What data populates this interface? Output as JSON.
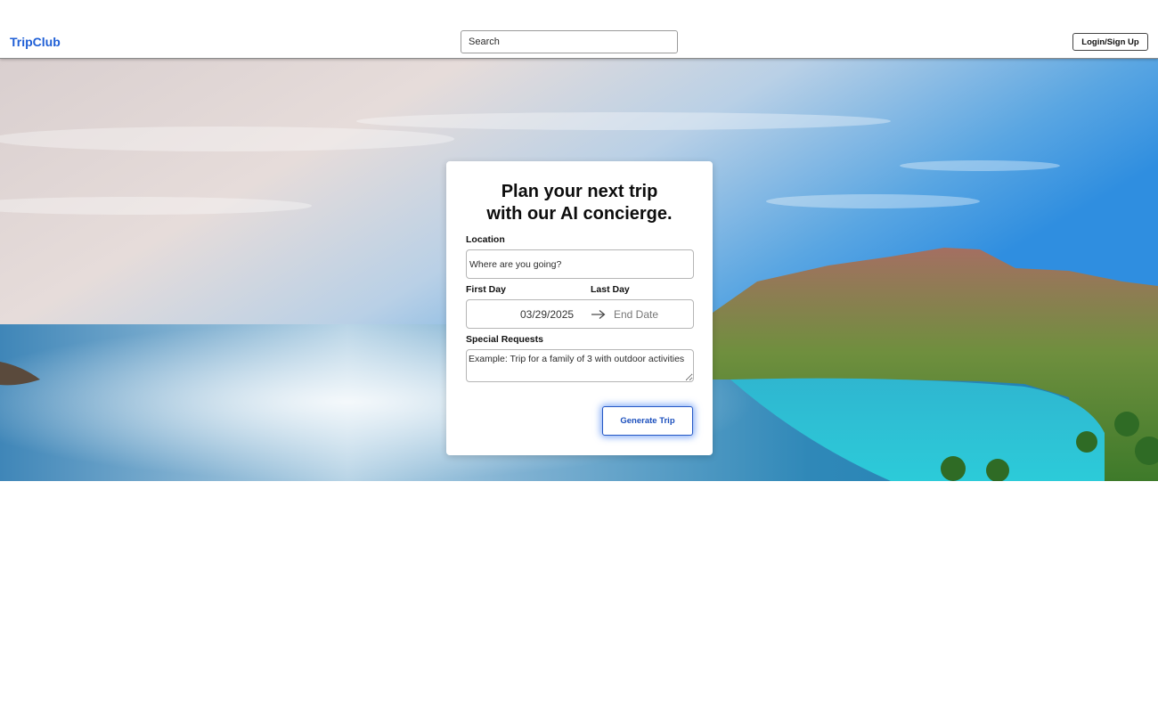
{
  "header": {
    "brand": "TripClub",
    "search_placeholder": "Search",
    "login_label": "Login/Sign Up"
  },
  "planner": {
    "title_line1": "Plan your next trip",
    "title_line2": "with our AI concierge.",
    "location_label": "Location",
    "location_placeholder": "Where are you going?",
    "first_day_label": "First Day",
    "last_day_label": "Last Day",
    "start_date": "03/29/2025",
    "end_date_placeholder": "End Date",
    "requests_label": "Special Requests",
    "requests_placeholder": "Example: Trip for a family of 3 with outdoor activities",
    "generate_label": "Generate Trip"
  },
  "colors": {
    "brand": "#1f5fd6",
    "button_glow": "#286ef0"
  },
  "icons": {
    "date_arrow": "arrow-right-icon"
  }
}
